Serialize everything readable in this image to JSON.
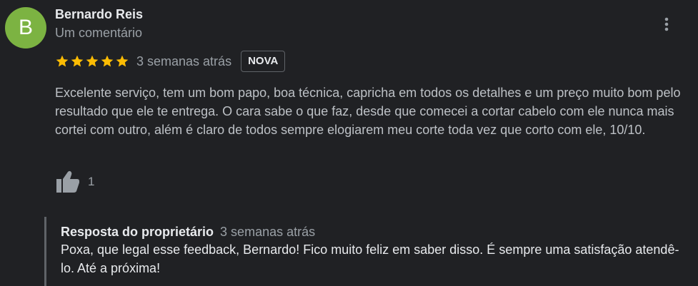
{
  "review": {
    "avatar_letter": "B",
    "avatar_color": "#7cb342",
    "author_name": "Bernardo Reis",
    "author_meta": "Um comentário",
    "rating": 5,
    "star_color": "#fbbc04",
    "date": "3 semanas atrás",
    "badge": "NOVA",
    "text": "Excelente serviço, tem um bom papo, boa técnica, capricha em todos os detalhes e um preço muito bom pelo resultado que ele te entrega. O cara sabe o que faz, desde que comecei a cortar cabelo com ele nunca mais cortei com outro, além é claro de todos sempre elogiarem meu corte toda vez que corto com ele, 10/10.",
    "like_count": "1",
    "icons": {
      "more": "more-vert-icon",
      "like": "thumbs-up-icon",
      "star": "star-icon"
    }
  },
  "owner_reply": {
    "title": "Resposta do proprietário",
    "date": "3 semanas atrás",
    "text": "Poxa, que legal esse feedback, Bernardo! Fico muito feliz em saber disso. É sempre uma satisfação atendê-lo. Até a próxima!"
  }
}
